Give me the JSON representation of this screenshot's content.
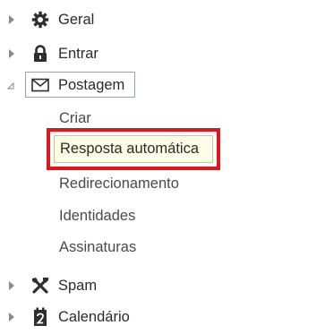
{
  "tree": {
    "items": [
      {
        "label": "Geral",
        "icon": "gear-icon",
        "state": "collapsed"
      },
      {
        "label": "Entrar",
        "icon": "lock-icon",
        "state": "collapsed"
      },
      {
        "label": "Postagem",
        "icon": "mail-icon",
        "state": "expanded",
        "children": [
          {
            "label": "Criar"
          },
          {
            "label": "Resposta automática",
            "selected": true
          },
          {
            "label": "Redirecionamento"
          },
          {
            "label": "Identidades"
          },
          {
            "label": "Assinaturas"
          }
        ]
      },
      {
        "label": "Spam",
        "icon": "tools-icon",
        "state": "collapsed"
      },
      {
        "label": "Calendário",
        "icon": "calendar-icon",
        "state": "collapsed"
      }
    ]
  },
  "colors": {
    "highlight_border": "#e0161b",
    "selected_bg": "#fdfce4"
  }
}
